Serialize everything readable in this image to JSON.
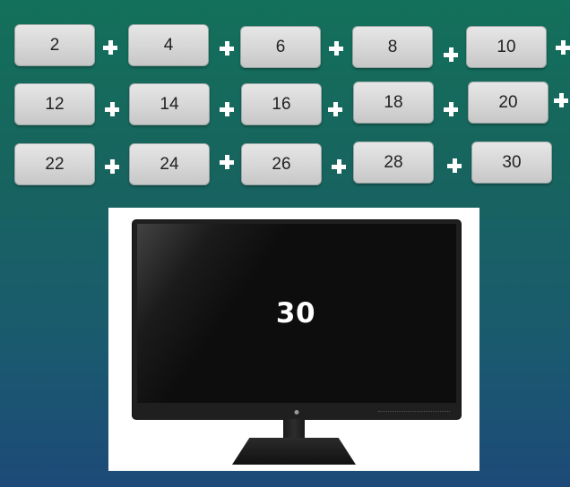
{
  "tiles": [
    {
      "label": "2"
    },
    {
      "label": "4"
    },
    {
      "label": "6"
    },
    {
      "label": "8"
    },
    {
      "label": "10"
    },
    {
      "label": "12"
    },
    {
      "label": "14"
    },
    {
      "label": "16"
    },
    {
      "label": "18"
    },
    {
      "label": "20"
    },
    {
      "label": "22"
    },
    {
      "label": "24"
    },
    {
      "label": "26"
    },
    {
      "label": "28"
    },
    {
      "label": "30"
    }
  ],
  "monitor": {
    "display_value": "30",
    "brand_icon": "lg-logo-icon"
  },
  "colors": {
    "background_top": "#13705a",
    "background_bottom": "#1d4a78",
    "tile_fill": "#d6d6d6",
    "plus_sign": "#ffffff",
    "screen_text": "#ffffff"
  },
  "icons": {
    "operator": "plus-icon"
  }
}
